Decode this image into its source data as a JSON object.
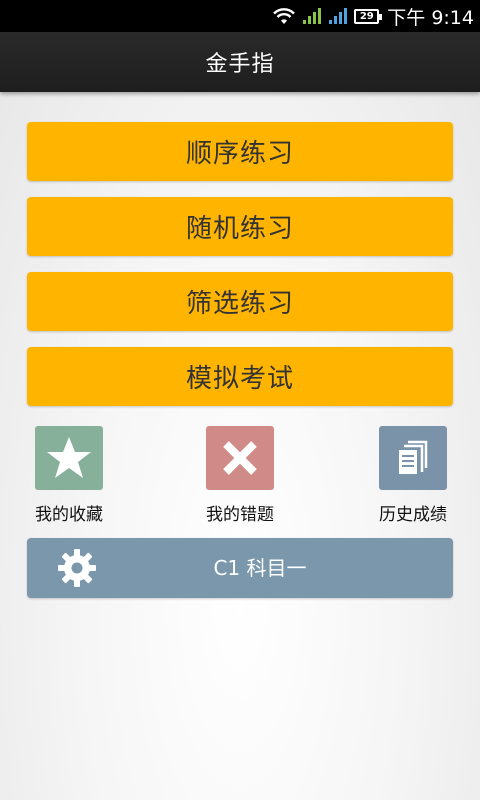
{
  "status_bar": {
    "time": "下午 9:14",
    "battery": "29",
    "icons": [
      "wifi-icon",
      "signal-icon",
      "signal-icon",
      "battery-icon"
    ]
  },
  "app_bar": {
    "title": "金手指"
  },
  "menu": {
    "items": [
      {
        "label": "顺序练习"
      },
      {
        "label": "随机练习"
      },
      {
        "label": "筛选练习"
      },
      {
        "label": "模拟考试"
      }
    ],
    "button_color": "#ffb400"
  },
  "shortcuts": [
    {
      "label": "我的收藏",
      "icon": "star-icon",
      "color": "#86b09a"
    },
    {
      "label": "我的错题",
      "icon": "close-icon",
      "color": "#d08b88"
    },
    {
      "label": "历史成绩",
      "icon": "documents-icon",
      "color": "#7b93a8"
    }
  ],
  "subject": {
    "label": "C1 科目一",
    "icon": "gear-icon",
    "color": "#7a97ab"
  }
}
